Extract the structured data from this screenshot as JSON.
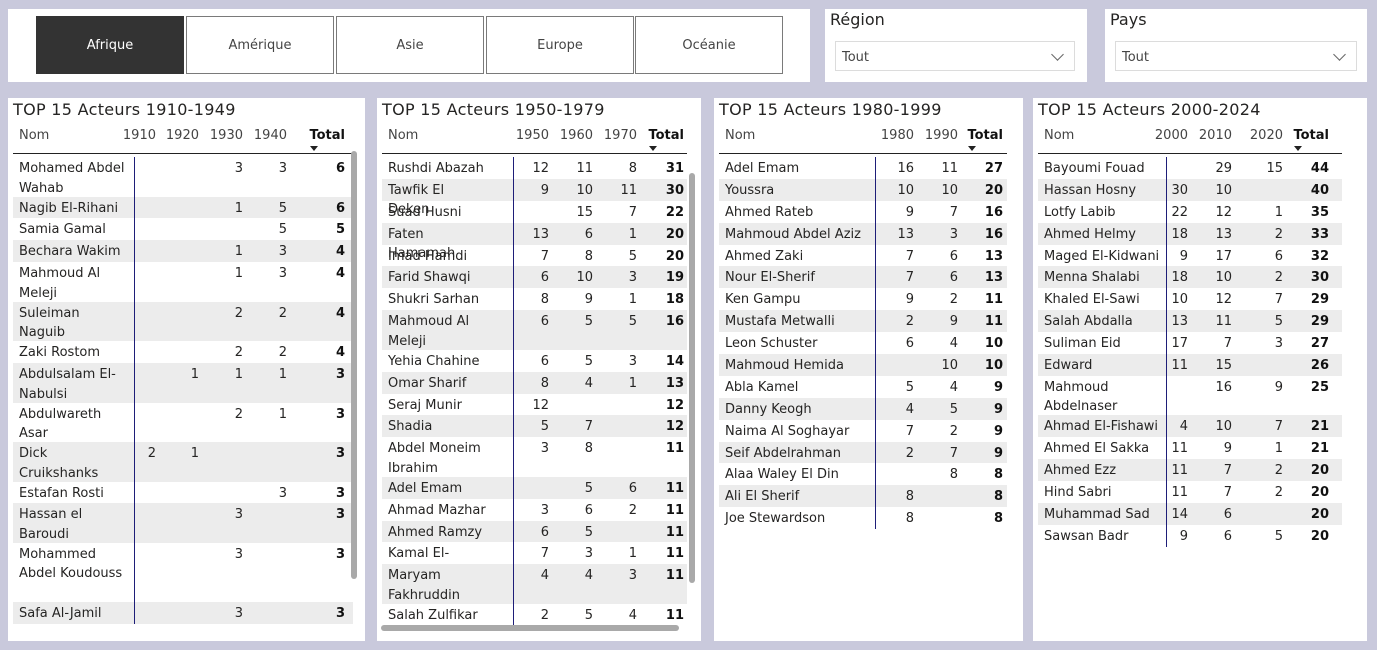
{
  "continents": [
    {
      "label": "Afrique",
      "active": true
    },
    {
      "label": "Amérique",
      "active": false
    },
    {
      "label": "Asie",
      "active": false
    },
    {
      "label": "Europe",
      "active": false
    },
    {
      "label": "Océanie",
      "active": false
    }
  ],
  "region": {
    "title": "Région",
    "value": "Tout"
  },
  "pays": {
    "title": "Pays",
    "value": "Tout"
  },
  "tables": [
    {
      "title": "TOP 15 Acteurs 1910-1949",
      "nom_label": "Nom",
      "total_label": "Total",
      "years": [
        "1910",
        "1920",
        "1930",
        "1940"
      ],
      "rows": [
        {
          "nom": "Mohamed Abdel Wahab",
          "vals": [
            "",
            "",
            "3",
            "3"
          ],
          "total": "6"
        },
        {
          "nom": "Nagib El-Rihani",
          "vals": [
            "",
            "",
            "1",
            "5"
          ],
          "total": "6"
        },
        {
          "nom": "Samia Gamal",
          "vals": [
            "",
            "",
            "",
            "5"
          ],
          "total": "5"
        },
        {
          "nom": "Bechara Wakim",
          "vals": [
            "",
            "",
            "1",
            "3"
          ],
          "total": "4"
        },
        {
          "nom": "Mahmoud Al Meleji",
          "vals": [
            "",
            "",
            "1",
            "3"
          ],
          "total": "4"
        },
        {
          "nom": "Suleiman Naguib",
          "vals": [
            "",
            "",
            "2",
            "2"
          ],
          "total": "4"
        },
        {
          "nom": "Zaki Rostom",
          "vals": [
            "",
            "",
            "2",
            "2"
          ],
          "total": "4"
        },
        {
          "nom": "Abdulsalam El-Nabulsi",
          "vals": [
            "",
            "1",
            "1",
            "1"
          ],
          "total": "3"
        },
        {
          "nom": "Abdulwareth Asar",
          "vals": [
            "",
            "",
            "2",
            "1"
          ],
          "total": "3"
        },
        {
          "nom": "Dick Cruikshanks",
          "vals": [
            "2",
            "1",
            "",
            ""
          ],
          "total": "3"
        },
        {
          "nom": "Estafan Rosti",
          "vals": [
            "",
            "",
            "",
            "3"
          ],
          "total": "3"
        },
        {
          "nom": "Hassan el Baroudi",
          "vals": [
            "",
            "",
            "3",
            ""
          ],
          "total": "3"
        },
        {
          "nom": "Mohammed Abdel Koudouss",
          "vals": [
            "",
            "",
            "3",
            ""
          ],
          "total": "3"
        },
        {
          "nom": "Safa Al-Jamil",
          "vals": [
            "",
            "",
            "3",
            ""
          ],
          "total": "3"
        }
      ]
    },
    {
      "title": "TOP 15 Acteurs 1950-1979",
      "nom_label": "Nom",
      "total_label": "Total",
      "years": [
        "1950",
        "1960",
        "1970"
      ],
      "rows": [
        {
          "nom": "Rushdi Abazah",
          "vals": [
            "12",
            "11",
            "8"
          ],
          "total": "31"
        },
        {
          "nom": "Tawfik El Deken",
          "vals": [
            "9",
            "10",
            "11"
          ],
          "total": "30"
        },
        {
          "nom": "Suad Husni",
          "vals": [
            "",
            "15",
            "7"
          ],
          "total": "22"
        },
        {
          "nom": "Faten Hamamah",
          "vals": [
            "13",
            "6",
            "1"
          ],
          "total": "20"
        },
        {
          "nom": "Imad Hamdi",
          "vals": [
            "7",
            "8",
            "5"
          ],
          "total": "20"
        },
        {
          "nom": "Farid Shawqi",
          "vals": [
            "6",
            "10",
            "3"
          ],
          "total": "19"
        },
        {
          "nom": "Shukri Sarhan",
          "vals": [
            "8",
            "9",
            "1"
          ],
          "total": "18"
        },
        {
          "nom": "Mahmoud Al Meleji",
          "vals": [
            "6",
            "5",
            "5"
          ],
          "total": "16"
        },
        {
          "nom": "Yehia Chahine",
          "vals": [
            "6",
            "5",
            "3"
          ],
          "total": "14"
        },
        {
          "nom": "Omar Sharif",
          "vals": [
            "8",
            "4",
            "1"
          ],
          "total": "13"
        },
        {
          "nom": "Seraj Munir",
          "vals": [
            "12",
            "",
            ""
          ],
          "total": "12"
        },
        {
          "nom": "Shadia",
          "vals": [
            "5",
            "7",
            ""
          ],
          "total": "12"
        },
        {
          "nom": "Abdel Moneim Ibrahim",
          "vals": [
            "3",
            "8",
            ""
          ],
          "total": "11"
        },
        {
          "nom": "Adel Emam",
          "vals": [
            "",
            "5",
            "6"
          ],
          "total": "11"
        },
        {
          "nom": "Ahmad Mazhar",
          "vals": [
            "3",
            "6",
            "2"
          ],
          "total": "11"
        },
        {
          "nom": "Ahmed Ramzy",
          "vals": [
            "6",
            "5",
            ""
          ],
          "total": "11"
        },
        {
          "nom": "Kamal El-Shinnawi",
          "vals": [
            "7",
            "3",
            "1"
          ],
          "total": "11"
        },
        {
          "nom": "Maryam Fakhruddin",
          "vals": [
            "4",
            "4",
            "3"
          ],
          "total": "11"
        },
        {
          "nom": "Salah Zulfikar",
          "vals": [
            "2",
            "5",
            "4"
          ],
          "total": "11"
        }
      ]
    },
    {
      "title": "TOP 15 Acteurs 1980-1999",
      "nom_label": "Nom",
      "total_label": "Total",
      "years": [
        "1980",
        "1990"
      ],
      "rows": [
        {
          "nom": "Adel Emam",
          "vals": [
            "16",
            "11"
          ],
          "total": "27"
        },
        {
          "nom": "Youssra",
          "vals": [
            "10",
            "10"
          ],
          "total": "20"
        },
        {
          "nom": "Ahmed Rateb",
          "vals": [
            "9",
            "7"
          ],
          "total": "16"
        },
        {
          "nom": "Mahmoud Abdel Aziz",
          "vals": [
            "13",
            "3"
          ],
          "total": "16"
        },
        {
          "nom": "Ahmed Zaki",
          "vals": [
            "7",
            "6"
          ],
          "total": "13"
        },
        {
          "nom": "Nour El-Sherif",
          "vals": [
            "7",
            "6"
          ],
          "total": "13"
        },
        {
          "nom": "Ken Gampu",
          "vals": [
            "9",
            "2"
          ],
          "total": "11"
        },
        {
          "nom": "Mustafa Metwalli",
          "vals": [
            "2",
            "9"
          ],
          "total": "11"
        },
        {
          "nom": "Leon Schuster",
          "vals": [
            "6",
            "4"
          ],
          "total": "10"
        },
        {
          "nom": "Mahmoud Hemida",
          "vals": [
            "",
            "10"
          ],
          "total": "10"
        },
        {
          "nom": "Abla Kamel",
          "vals": [
            "5",
            "4"
          ],
          "total": "9"
        },
        {
          "nom": "Danny Keogh",
          "vals": [
            "4",
            "5"
          ],
          "total": "9"
        },
        {
          "nom": "Naima Al Soghayar",
          "vals": [
            "7",
            "2"
          ],
          "total": "9"
        },
        {
          "nom": "Seif Abdelrahman",
          "vals": [
            "2",
            "7"
          ],
          "total": "9"
        },
        {
          "nom": "Alaa Waley El Din",
          "vals": [
            "",
            "8"
          ],
          "total": "8"
        },
        {
          "nom": "Ali El Sherif",
          "vals": [
            "8",
            ""
          ],
          "total": "8"
        },
        {
          "nom": "Joe Stewardson",
          "vals": [
            "8",
            ""
          ],
          "total": "8"
        }
      ]
    },
    {
      "title": "TOP 15 Acteurs 2000-2024",
      "nom_label": "Nom",
      "total_label": "Total",
      "years": [
        "2000",
        "2010",
        "2020"
      ],
      "rows": [
        {
          "nom": "Bayoumi Fouad",
          "vals": [
            "",
            "29",
            "15"
          ],
          "total": "44"
        },
        {
          "nom": "Hassan Hosny",
          "vals": [
            "30",
            "10",
            ""
          ],
          "total": "40"
        },
        {
          "nom": "Lotfy Labib",
          "vals": [
            "22",
            "12",
            "1"
          ],
          "total": "35"
        },
        {
          "nom": "Ahmed Helmy",
          "vals": [
            "18",
            "13",
            "2"
          ],
          "total": "33"
        },
        {
          "nom": "Maged El-Kidwani",
          "vals": [
            "9",
            "17",
            "6"
          ],
          "total": "32"
        },
        {
          "nom": "Menna Shalabi",
          "vals": [
            "18",
            "10",
            "2"
          ],
          "total": "30"
        },
        {
          "nom": "Khaled El-Sawi",
          "vals": [
            "10",
            "12",
            "7"
          ],
          "total": "29"
        },
        {
          "nom": "Salah Abdalla",
          "vals": [
            "13",
            "11",
            "5"
          ],
          "total": "29"
        },
        {
          "nom": "Suliman Eid",
          "vals": [
            "17",
            "7",
            "3"
          ],
          "total": "27"
        },
        {
          "nom": "Edward",
          "vals": [
            "11",
            "15",
            ""
          ],
          "total": "26"
        },
        {
          "nom": "Mahmoud Abdelnaser",
          "vals": [
            "",
            "16",
            "9"
          ],
          "total": "25"
        },
        {
          "nom": "Ahmad El-Fishawi",
          "vals": [
            "4",
            "10",
            "7"
          ],
          "total": "21"
        },
        {
          "nom": "Ahmed El Sakka",
          "vals": [
            "11",
            "9",
            "1"
          ],
          "total": "21"
        },
        {
          "nom": "Ahmed Ezz",
          "vals": [
            "11",
            "7",
            "2"
          ],
          "total": "20"
        },
        {
          "nom": "Hind Sabri",
          "vals": [
            "11",
            "7",
            "2"
          ],
          "total": "20"
        },
        {
          "nom": "Muhammad Sad",
          "vals": [
            "14",
            "6",
            ""
          ],
          "total": "20"
        },
        {
          "nom": "Sawsan Badr",
          "vals": [
            "9",
            "6",
            "5"
          ],
          "total": "20"
        }
      ]
    }
  ]
}
